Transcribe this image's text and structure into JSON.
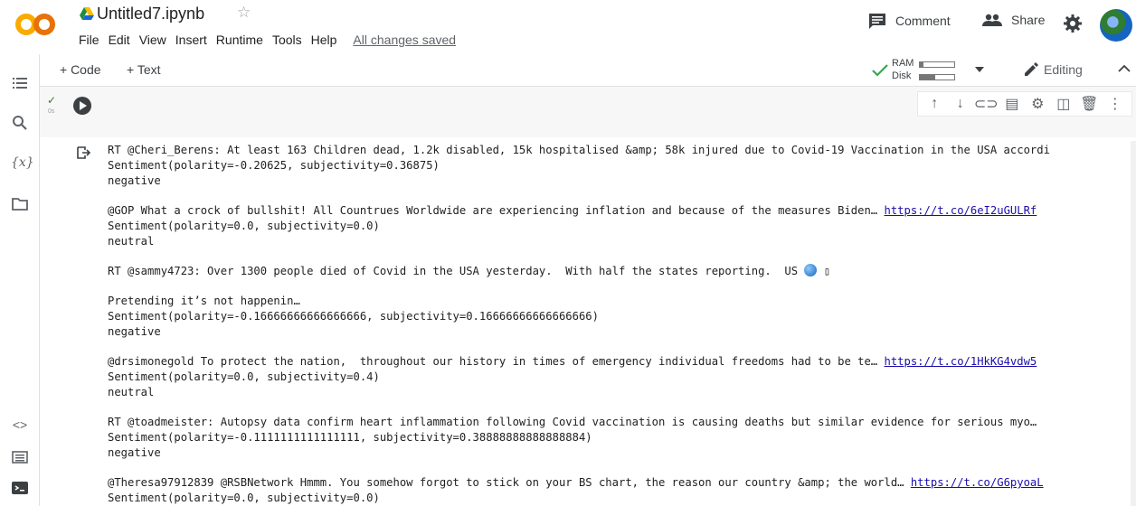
{
  "header": {
    "title": "Untitled7.ipynb",
    "menu": [
      "File",
      "Edit",
      "View",
      "Insert",
      "Runtime",
      "Tools",
      "Help"
    ],
    "saved_status": "All changes saved",
    "comment_label": "Comment",
    "share_label": "Share"
  },
  "toolbar": {
    "add_code": "+ Code",
    "add_text": "+ Text",
    "ram_label": "RAM",
    "disk_label": "Disk",
    "ram_fraction": 0.1,
    "disk_fraction": 0.45,
    "editing_label": "Editing"
  },
  "cell": {
    "exec_label": "0s"
  },
  "output": [
    {
      "text": "RT @Cheri_Berens: At least 163 Children dead, 1.2k disabled, 15k hospitalised &amp; 58k injured due to Covid-19 Vaccination in the USA accordi",
      "link": ""
    },
    {
      "text": "Sentiment(polarity=-0.20625, subjectivity=0.36875)",
      "link": ""
    },
    {
      "text": "negative",
      "link": ""
    },
    {
      "text": "",
      "link": ""
    },
    {
      "text": "@GOP What a crock of bullshit! All Countrues Worldwide are experiencing inflation and because of the measures Biden… ",
      "link": "https://t.co/6eI2uGULRf"
    },
    {
      "text": "Sentiment(polarity=0.0, subjectivity=0.0)",
      "link": ""
    },
    {
      "text": "neutral",
      "link": ""
    },
    {
      "text": "",
      "link": ""
    },
    {
      "text": "RT @sammy4723: Over 1300 people died of Covid in the USA yesterday.  With half the states reporting.  US ",
      "link": "",
      "emoji": true
    },
    {
      "text": "",
      "link": ""
    },
    {
      "text": "Pretending it’s not happenin…",
      "link": ""
    },
    {
      "text": "Sentiment(polarity=-0.16666666666666666, subjectivity=0.16666666666666666)",
      "link": ""
    },
    {
      "text": "negative",
      "link": ""
    },
    {
      "text": "",
      "link": ""
    },
    {
      "text": "@drsimonegold To protect the nation,  throughout our history in times of emergency individual freedoms had to be te… ",
      "link": "https://t.co/1HkKG4vdw5"
    },
    {
      "text": "Sentiment(polarity=0.0, subjectivity=0.4)",
      "link": ""
    },
    {
      "text": "neutral",
      "link": ""
    },
    {
      "text": "",
      "link": ""
    },
    {
      "text": "RT @toadmeister: Autopsy data confirm heart inflammation following Covid vaccination is causing deaths but similar evidence for serious myo…",
      "link": ""
    },
    {
      "text": "Sentiment(polarity=-0.1111111111111111, subjectivity=0.38888888888888884)",
      "link": ""
    },
    {
      "text": "negative",
      "link": ""
    },
    {
      "text": "",
      "link": ""
    },
    {
      "text": "@Theresa97912839 @RSBNetwork Hmmm. You somehow forgot to stick on your BS chart, the reason our country &amp; the world… ",
      "link": "https://t.co/G6pyoaL"
    },
    {
      "text": "Sentiment(polarity=0.0, subjectivity=0.0)",
      "link": ""
    }
  ]
}
